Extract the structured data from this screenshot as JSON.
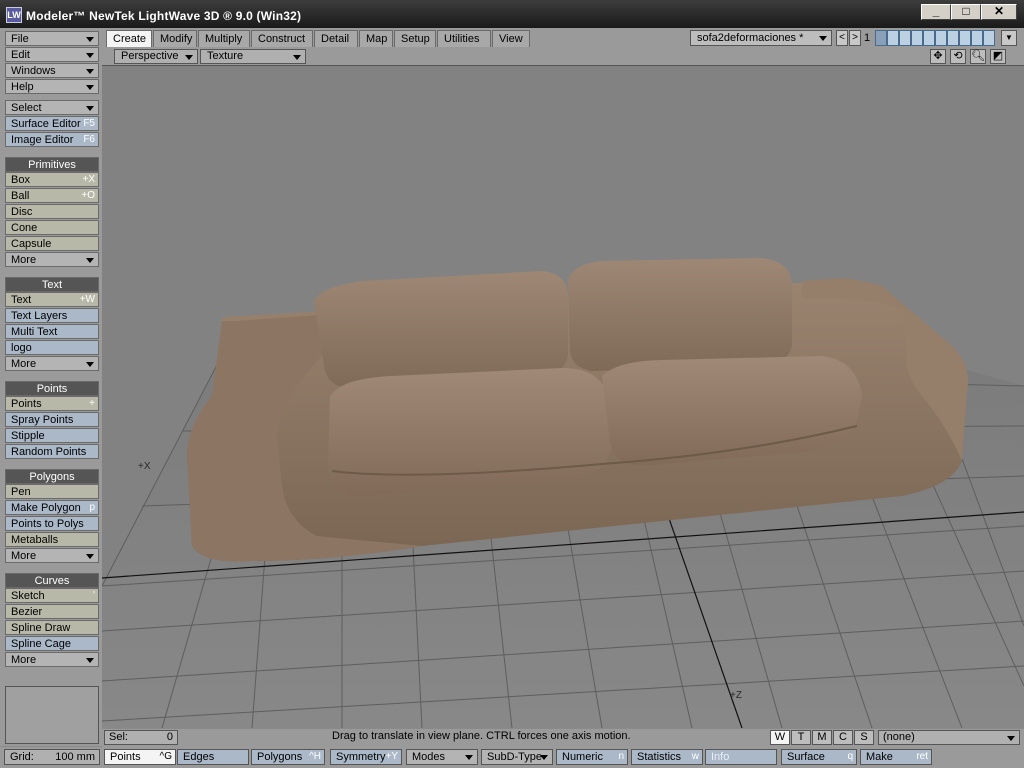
{
  "window": {
    "title": "Modeler™ NewTek LightWave 3D ® 9.0 (Win32)",
    "controls": {
      "minimize": "_",
      "maximize": "□",
      "close": "✕"
    }
  },
  "tabs": [
    "Create",
    "Modify",
    "Multiply",
    "Construct",
    "Detail",
    "Map",
    "Setup",
    "Utilities",
    "View"
  ],
  "active_tab": "Create",
  "scene": {
    "selector": "sofa2deformaciones *",
    "prev": "<",
    "next": ">",
    "layer_number": "1"
  },
  "menu": {
    "file": "File",
    "edit": "Edit",
    "windows": "Windows",
    "help": "Help",
    "select": "Select",
    "surface_editor": "Surface Editor",
    "surface_editor_sc": "F5",
    "image_editor": "Image Editor",
    "image_editor_sc": "F6"
  },
  "primitives": {
    "header": "Primitives",
    "box": "Box",
    "box_sc": "+X",
    "ball": "Ball",
    "ball_sc": "+O",
    "disc": "Disc",
    "cone": "Cone",
    "capsule": "Capsule",
    "more": "More"
  },
  "text_group": {
    "header": "Text",
    "text": "Text",
    "text_sc": "+W",
    "text_layers": "Text Layers",
    "multi_text": "Multi Text",
    "logo": "logo",
    "more": "More"
  },
  "points_group": {
    "header": "Points",
    "points": "Points",
    "points_sc": "+",
    "spray_points": "Spray Points",
    "stipple": "Stipple",
    "random_points": "Random Points"
  },
  "polygons_group": {
    "header": "Polygons",
    "pen": "Pen",
    "make_polygon": "Make Polygon",
    "make_polygon_sc": "p",
    "points_to_polys": "Points to Polys",
    "metaballs": "Metaballs",
    "more": "More"
  },
  "curves_group": {
    "header": "Curves",
    "sketch": "Sketch",
    "sketch_sc": "'",
    "bezier": "Bezier",
    "spline_draw": "Spline Draw",
    "spline_cage": "Spline Cage",
    "more": "More"
  },
  "viewport": {
    "view_mode": "Perspective",
    "render_mode": "Texture",
    "axis_x": "+X",
    "axis_z": "+Z",
    "icons": [
      "move-view-icon",
      "rotate-view-icon",
      "zoom-view-icon",
      "maximize-view-icon"
    ],
    "object_color": "#8c7663"
  },
  "status": {
    "sel_label": "Sel:",
    "sel_value": "0",
    "message": "Drag to translate in view plane. CTRL forces one axis motion.",
    "wtmcs": [
      "W",
      "T",
      "M",
      "C",
      "S"
    ],
    "wtmcs_active": "W",
    "surface_select": "(none)"
  },
  "bottom": {
    "grid_label": "Grid:",
    "grid_value": "100 mm",
    "points": "Points",
    "points_sc": "^G",
    "edges": "Edges",
    "polygons": "Polygons",
    "polygons_sc": "^H",
    "symmetry": "Symmetry",
    "symmetry_sc": "+Y",
    "modes": "Modes",
    "subd_type": "SubD-Type",
    "numeric": "Numeric",
    "numeric_sc": "n",
    "statistics": "Statistics",
    "statistics_sc": "w",
    "info": "Info",
    "surface": "Surface",
    "surface_sc": "q",
    "make": "Make",
    "make_sc": "ret"
  }
}
